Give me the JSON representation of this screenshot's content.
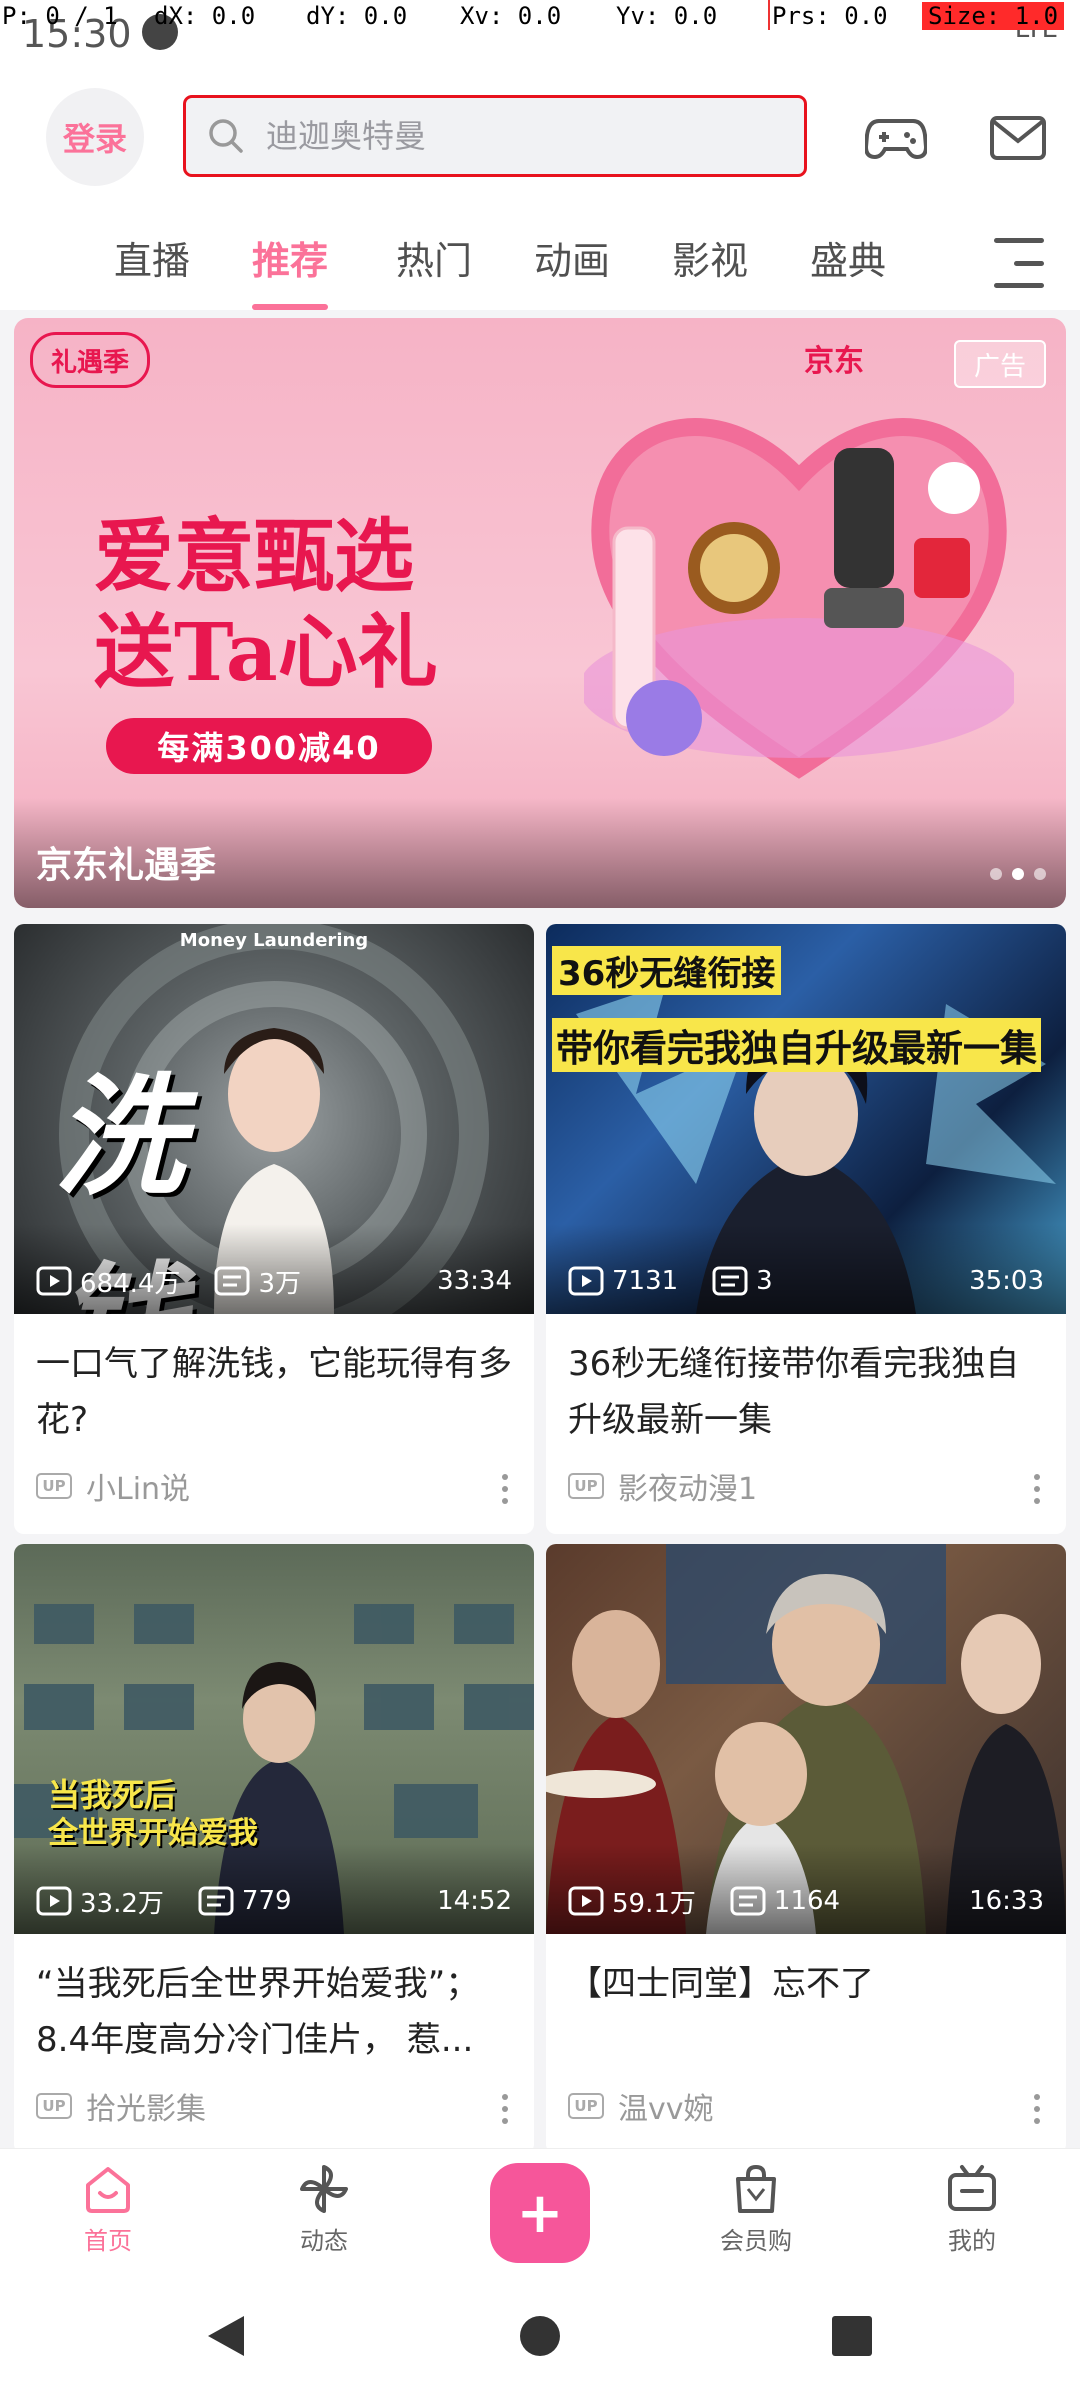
{
  "status": {
    "time": "15:30",
    "network": "LTE"
  },
  "debug": {
    "pointer": "P: 0 / 1",
    "dx": "dX: 0.0",
    "dy": "dY: 0.0",
    "xv": "Xv: 0.0",
    "yv": "Yv: 0.0",
    "prs": "Prs: 0.0",
    "size": "Size: 1.0"
  },
  "header": {
    "login_label": "登录",
    "search_placeholder": "迪迦奥特曼",
    "game_icon": "gamepad-icon",
    "mail_icon": "mail-icon"
  },
  "tabs": [
    {
      "label": "直播",
      "active": false
    },
    {
      "label": "推荐",
      "active": true
    },
    {
      "label": "热门",
      "active": false
    },
    {
      "label": "动画",
      "active": false
    },
    {
      "label": "影视",
      "active": false
    },
    {
      "label": "盛典",
      "active": false
    }
  ],
  "banner": {
    "brand_left": "礼遇季",
    "brand_right": "京东",
    "ad_tag": "广告",
    "headline_1": "爱意甄选",
    "headline_2": "送Ta心礼",
    "promo": "每满300减40",
    "caption": "京东礼遇季",
    "page_index": 2,
    "page_count": 3
  },
  "videos": [
    {
      "thumb_label": "Money Laundering",
      "thumb_text": "洗 钱",
      "views": "684.4万",
      "danmaku": "3万",
      "duration": "33:34",
      "title": "一口气了解洗钱，它能玩得有多花?",
      "uploader": "小Lin说"
    },
    {
      "thumb_label": "36秒无缝衔接",
      "thumb_text": "带你看完我独自升级最新一集",
      "views": "7131",
      "danmaku": "3",
      "duration": "35:03",
      "title": "36秒无缝衔接带你看完我独自升级最新一集",
      "uploader": "影夜动漫1"
    },
    {
      "thumb_label": "当我死后",
      "thumb_text": "全世界开始爱我",
      "views": "33.2万",
      "danmaku": "779",
      "duration": "14:52",
      "title": "“当我死后全世界开始爱我”；8.4年度高分冷门佳片， 惹...",
      "uploader": "拾光影集"
    },
    {
      "thumb_label": "",
      "thumb_text": "",
      "views": "59.1万",
      "danmaku": "1164",
      "duration": "16:33",
      "title": "【四士同堂】忘不了",
      "uploader": "温vv婉"
    }
  ],
  "up_badge": "UP",
  "bottom_nav": [
    {
      "label": "首页",
      "icon": "home-icon",
      "active": true
    },
    {
      "label": "动态",
      "icon": "pinwheel-icon",
      "active": false
    },
    {
      "label": "+",
      "icon": "plus-icon",
      "active": false
    },
    {
      "label": "会员购",
      "icon": "shopping-bag-icon",
      "active": false
    },
    {
      "label": "我的",
      "icon": "tv-icon",
      "active": false
    }
  ],
  "colors": {
    "accent": "#fb7299",
    "fab": "#f6569a",
    "banner_red": "#e8174f",
    "highlight_box": "#e8121d"
  }
}
